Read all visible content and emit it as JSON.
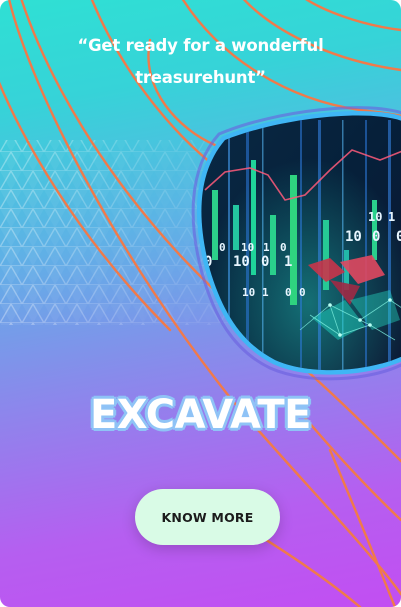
{
  "quote": {
    "line1": "“Get ready for a wonderful",
    "line2": "treasurehunt”"
  },
  "headline": "EXCAVATE",
  "cta": {
    "label": "KNOW MORE"
  },
  "image": {
    "icon": "data-visualization-image",
    "digits": [
      "0",
      "10",
      "1",
      "0",
      "10",
      "0",
      "1",
      "0",
      "10",
      "1",
      "0",
      "0",
      "10",
      "0",
      "10",
      "1",
      "0"
    ]
  },
  "colors": {
    "gradient_top": "#2fe0d4",
    "gradient_bottom": "#c24ef2",
    "accent_lines": "#f07a4a",
    "button_bg": "#d9fbe6",
    "ring": "#3fb6f5"
  }
}
